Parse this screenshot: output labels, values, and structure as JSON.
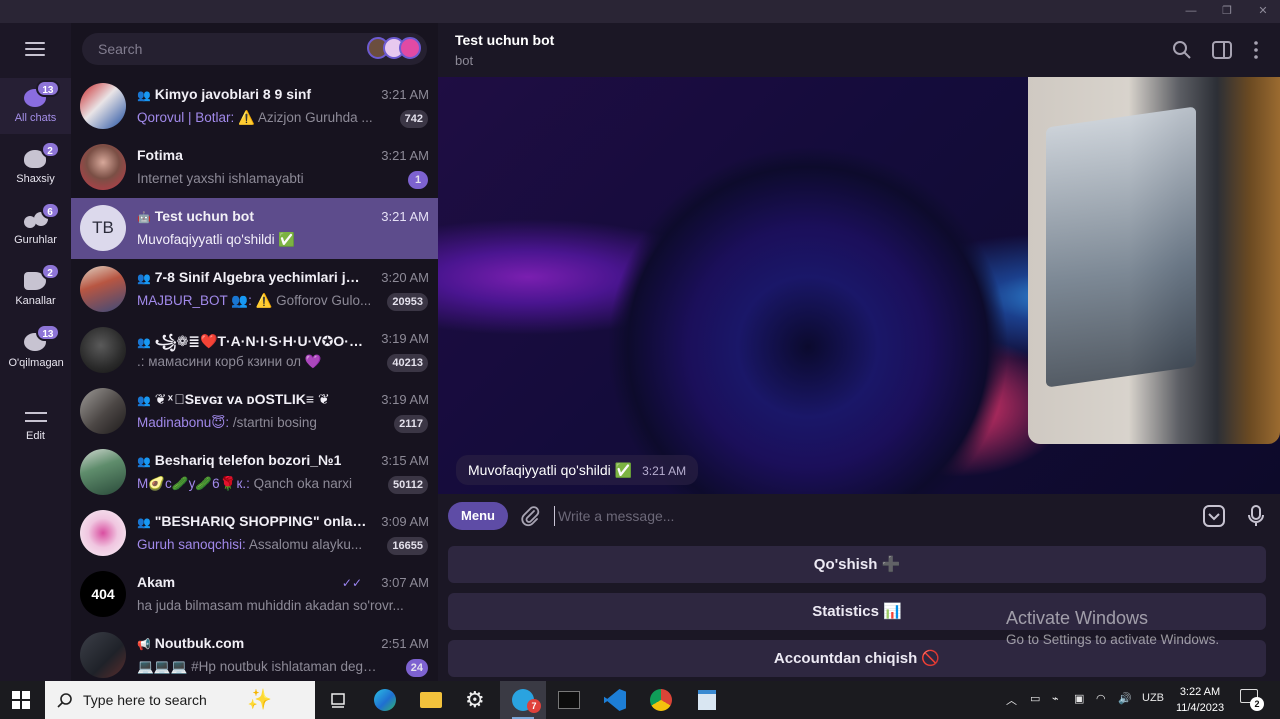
{
  "window": {
    "minimize": "—",
    "maximize": "❐",
    "close": "✕"
  },
  "folders": [
    {
      "label": "All chats",
      "badge": "13",
      "active": true
    },
    {
      "label": "Shaxsiy",
      "badge": "2"
    },
    {
      "label": "Guruhlar",
      "badge": "6"
    },
    {
      "label": "Kanallar",
      "badge": "2"
    },
    {
      "label": "O'qilmagan",
      "badge": "13"
    },
    {
      "label": "Edit"
    }
  ],
  "search": {
    "placeholder": "Search"
  },
  "chats": [
    {
      "name": "Kimyo javoblari 8 9 sinf",
      "time": "3:21 AM",
      "sender": "Qorovul | Botlar:",
      "preview": " ⚠️ Azizjon Guruhda ...",
      "badge": "742"
    },
    {
      "name": "Fotima",
      "time": "3:21 AM",
      "sender": "",
      "preview": "Internet yaxshi ishlamayabti",
      "badge": "1"
    },
    {
      "name": "Test uchun bot",
      "time": "3:21 AM",
      "sender": "",
      "preview": "Muvofaqiyyatli qo'shildi ✅",
      "badge": "",
      "avatar_text": "TB"
    },
    {
      "name": "7-8 Sinif Algebra yechimlari javob",
      "time": "3:20 AM",
      "sender": "MAJBUR_BOT 👥:",
      "preview": " ⚠️ Gofforov Gulo...",
      "badge": "20953"
    },
    {
      "name": "꧁❁≣❤️T·A·N·I·S·H·U·V✪O·L·...",
      "time": "3:19 AM",
      "sender": "",
      "preview": ".: мамасини корб кзини ол  💜",
      "badge": "40213"
    },
    {
      "name": "❦ ͯ  ⃟Sᴇᴠɢɪ ᴠᴀ ᴅOSTLIK≡  ❦",
      "time": "3:19 AM",
      "sender": "Madinabonu😇:",
      "preview": " /startni bosing",
      "badge": "2117"
    },
    {
      "name": "Beshariq telefon bozori_№1",
      "time": "3:15 AM",
      "sender": "M🥑с🥒у🥒6🌹к.:",
      "preview": " Qanch oka narxi",
      "badge": "50112"
    },
    {
      "name": "\"BESHARIQ SHOPPING\" onlayin ...",
      "time": "3:09 AM",
      "sender": "Guruh sanoqchisi:",
      "preview": " Assalomu alayku...",
      "badge": "16655"
    },
    {
      "name": "Akam",
      "time": "3:07 AM",
      "sender": "",
      "preview": "ha juda bilmasam muhiddin akadan so'rovr...",
      "badge": "",
      "read_ticks": "✓✓"
    },
    {
      "name": "Noutbuk.com",
      "time": "2:51 AM",
      "sender": "",
      "preview": "💻💻💻 #Hp  noutbuk ishlataman dega...",
      "badge": "24"
    }
  ],
  "header": {
    "title": "Test uchun bot",
    "subtitle": "bot"
  },
  "message": {
    "text": "Muvofaqiyyatli qo'shildi ✅",
    "time": "3:21 AM"
  },
  "composer": {
    "menu_label": "Menu",
    "placeholder": "Write a message..."
  },
  "keyboard": [
    "Qo'shish ➕",
    "Statistics 📊",
    "Accountdan chiqish 🚫"
  ],
  "watermark": {
    "title": "Activate Windows",
    "subtitle": "Go to Settings to activate Windows."
  },
  "taskbar": {
    "search_placeholder": "Type here to search",
    "telegram_badge": "7",
    "language": "UZB",
    "time": "3:22 AM",
    "date": "11/4/2023",
    "notifications": "2"
  },
  "colors": {
    "accent": "#7d62d0",
    "active_row": "#5d4c8c",
    "background": "#17131f"
  }
}
